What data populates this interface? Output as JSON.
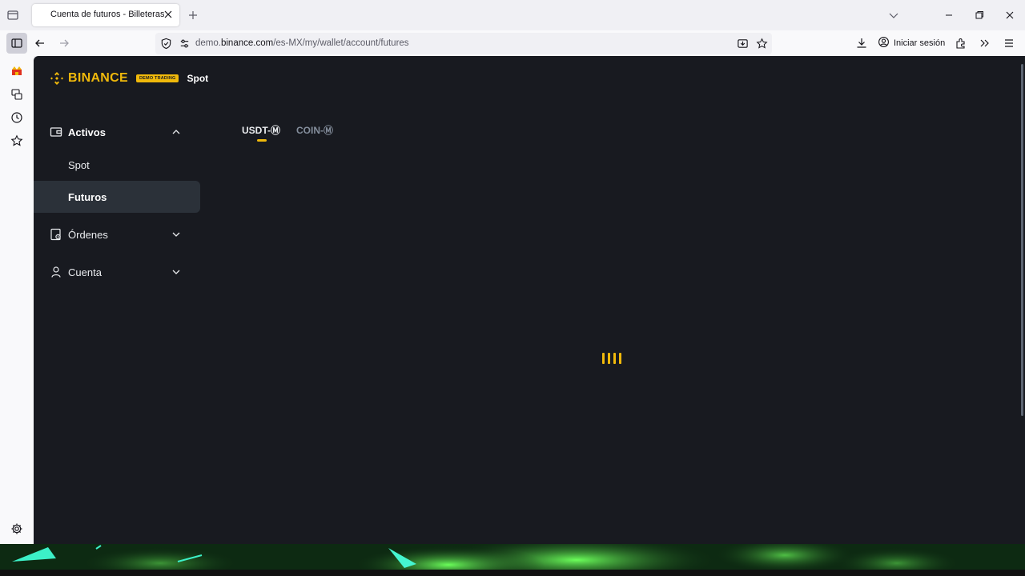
{
  "browser": {
    "tab_title": "Cuenta de futuros - Billeteras - ",
    "url_prefix": "demo.",
    "url_domain": "binance.com",
    "url_path": "/es-MX/my/wallet/account/futures",
    "signin_label": "Iniciar sesión"
  },
  "page": {
    "brand": "BINANCE",
    "demo_badge": "DEMO TRADING",
    "top_link": "Spot",
    "menu": {
      "assets": {
        "label": "Activos",
        "items": [
          "Spot",
          "Futuros"
        ]
      },
      "orders": {
        "label": "Órdenes"
      },
      "account": {
        "label": "Cuenta"
      }
    },
    "tabs": [
      "USDT-Ⓜ",
      "COIN-Ⓜ"
    ],
    "active_tab": "USDT-Ⓜ"
  },
  "colors": {
    "accent": "#f0b90b",
    "page_bg": "#181a20",
    "active_item_bg": "#2b3139"
  }
}
